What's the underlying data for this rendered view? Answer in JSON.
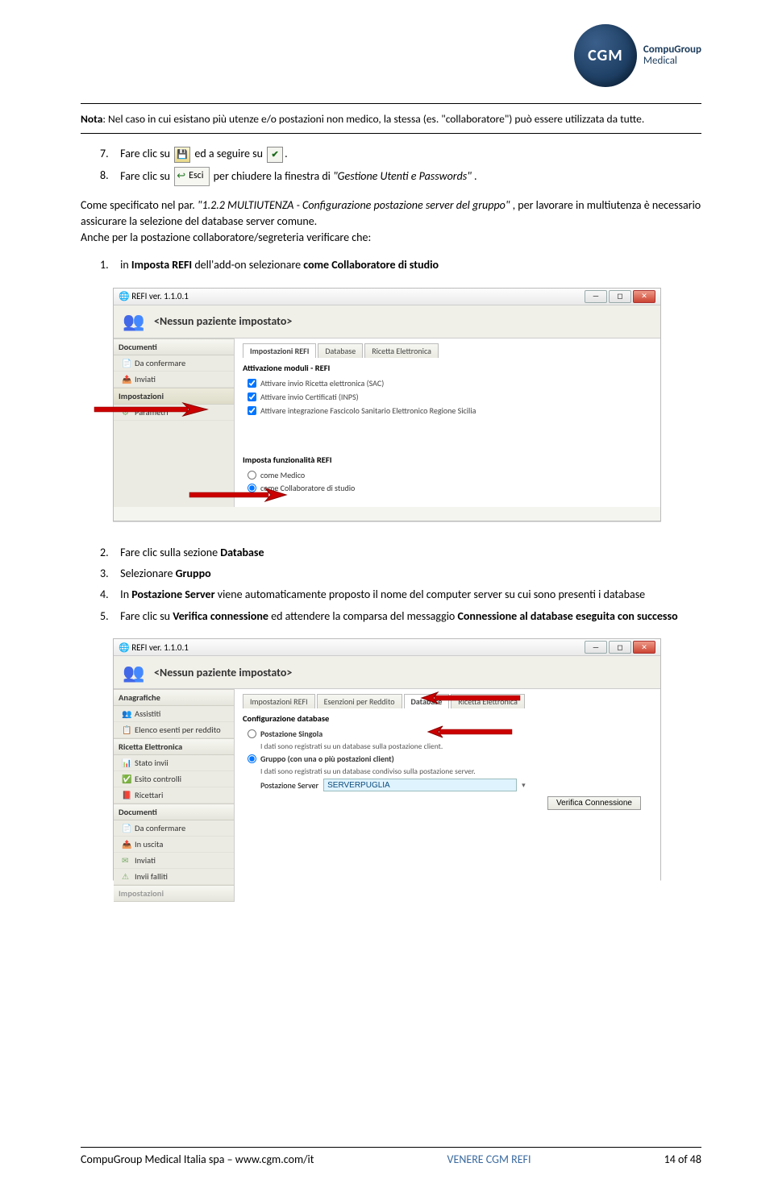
{
  "logo": {
    "abbr": "CGM",
    "line1": "CompuGroup",
    "line2": "Medical"
  },
  "note": {
    "label": "Nota",
    "body": ": Nel caso in cui esistano più utenze e/o postazioni non medico, la stessa (es. \"collaboratore\") può essere utilizzata da tutte."
  },
  "step7": {
    "num": "7.",
    "t1": "Fare clic su ",
    "t2": " ed a seguire su "
  },
  "step8": {
    "num": "8.",
    "t1": "Fare clic su ",
    "esci": "Esci",
    "t2": " per chiudere la finestra di ",
    "quoted": "\"Gestione Utenti e Passwords\"",
    "dot": "."
  },
  "paraA": {
    "t1": "Come specificato nel par. ",
    "ref_quote": "\"1.2.2 MULTIUTENZA - Configurazione postazione server del gruppo\"",
    "t2": ", per lavorare in multiutenza è necessario assicurare la selezione del database server comune.",
    "t3": "Anche per la postazione collaboratore/segreteria verificare che:"
  },
  "step1b": {
    "num": "1.",
    "t1": "in ",
    "b1": "Imposta REFI",
    "t2": " dell'add-on selezionare ",
    "b2": "come Collaboratore di studio"
  },
  "win1": {
    "title": "REFI ver. 1.1.0.1",
    "patient": "<Nessun paziente impostato>",
    "side_headers": {
      "documenti": "Documenti",
      "impostazioni": "Impostazioni"
    },
    "side_items": {
      "da_confermare": "Da confermare",
      "inviati": "Inviati",
      "parametri": "Parametri"
    },
    "tabs": {
      "impostazioni": "Impostazioni REFI",
      "database": "Database",
      "ricetta": "Ricetta Elettronica"
    },
    "section1": "Attivazione moduli - REFI",
    "chk1": "Attivare invio Ricetta elettronica (SAC)",
    "chk2": "Attivare invio Certificati (INPS)",
    "chk3": "Attivare integrazione Fascicolo Sanitario Elettronico Regione Sicilia",
    "section2": "Imposta funzionalità REFI",
    "r1": "come Medico",
    "r2": "come Collaboratore di studio"
  },
  "listB": {
    "i2": {
      "num": "2.",
      "t1": "Fare clic sulla sezione ",
      "b": "Database"
    },
    "i3": {
      "num": "3.",
      "t1": "Selezionare ",
      "b": "Gruppo"
    },
    "i4": {
      "num": "4.",
      "t1": "In ",
      "b": "Postazione Server",
      "t2": " viene automaticamente proposto il nome del computer server su cui sono presenti i database"
    },
    "i5": {
      "num": "5.",
      "t1": "Fare clic su ",
      "b1": "Verifica connessione",
      "t2": " ed attendere la comparsa del messaggio ",
      "b2": "Connessione al database eseguita con successo"
    }
  },
  "win2": {
    "title": "REFI ver. 1.1.0.1",
    "patient": "<Nessun paziente impostato>",
    "side_headers": {
      "anagrafiche": "Anagrafiche",
      "ricetta": "Ricetta Elettronica",
      "documenti": "Documenti",
      "impostazioni": "Impostazioni"
    },
    "side_items": {
      "assistiti": "Assistiti",
      "elenco": "Elenco esenti per reddito",
      "stato_invii": "Stato invii",
      "esito": "Esito controlli",
      "ricettari": "Ricettari",
      "da_confermare": "Da confermare",
      "in_uscita": "In uscita",
      "inviati": "Inviati",
      "invii_falliti": "Invii falliti"
    },
    "tabs": {
      "impostazioni": "Impostazioni REFI",
      "esenzioni": "Esenzioni per Reddito",
      "database": "Database",
      "ricetta": "Ricetta Elettronica"
    },
    "section": "Configurazione database",
    "r1": "Postazione Singola",
    "r1_sub": "I dati sono registrati su un database sulla postazione client.",
    "r2": "Gruppo (con una o più postazioni client)",
    "r2_sub": "I dati sono registrati su un database condiviso sulla postazione server.",
    "field_label": "Postazione Server",
    "field_value": "SERVERPUGLIA",
    "verify": "Verifica Connessione"
  },
  "footer": {
    "left": "CompuGroup Medical Italia spa – www.cgm.com/it",
    "mid": "VENERE CGM REFI",
    "right": "14 of 48"
  }
}
